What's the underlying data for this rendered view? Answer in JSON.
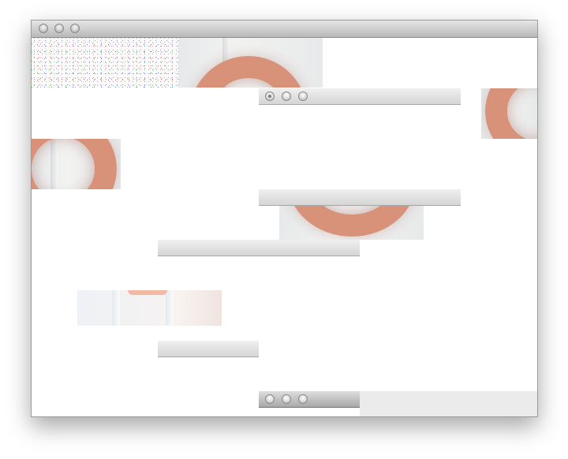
{
  "window": {
    "title": "",
    "controls": [
      "close-button",
      "minimize-button",
      "zoom-button"
    ]
  },
  "tiles": {
    "noise": "noise-tile",
    "photos": [
      "wreath-photo",
      "wreath-photo",
      "wreath-photo",
      "wreath-photo",
      "wreath-photo"
    ]
  },
  "sub_windows": [
    {
      "title": "",
      "controls": [
        "radio-selected",
        "radio",
        "radio"
      ]
    },
    {
      "title": "",
      "controls": []
    },
    {
      "title": "",
      "controls": []
    },
    {
      "title": "",
      "controls": []
    },
    {
      "title": "",
      "controls": [
        "radio",
        "radio",
        "radio"
      ]
    }
  ],
  "colors": {
    "wreath": "#d8927a",
    "titlebar_top": "#e6e6e6",
    "titlebar_bottom": "#b9b9b9",
    "panel": "#ebebeb"
  }
}
